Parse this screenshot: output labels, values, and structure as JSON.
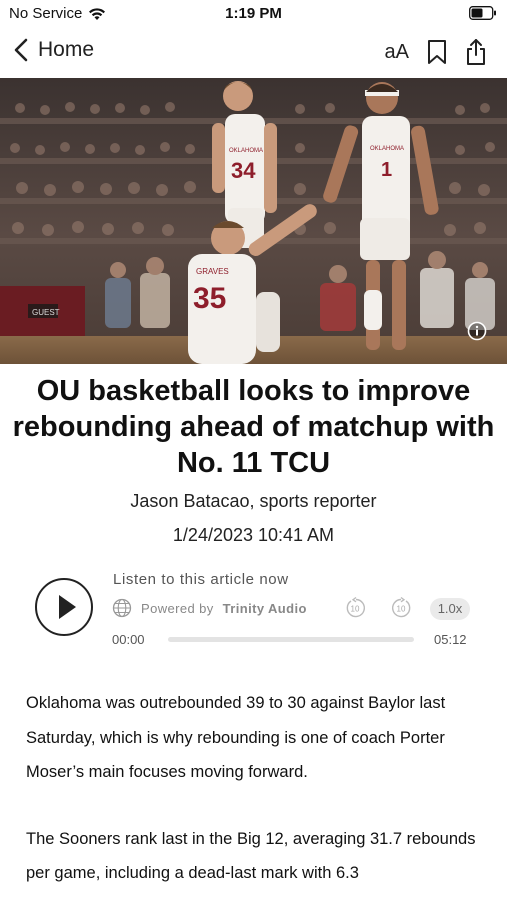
{
  "status_bar": {
    "carrier": "No Service",
    "time": "1:19 PM"
  },
  "nav": {
    "back_label": "Home",
    "font_size_label": "aA"
  },
  "hero": {
    "scoreboard_text": "GUEST",
    "jersey_left_name": "OKLAHOMA",
    "jersey_left_number": "34",
    "jersey_front_name": "GRAVES",
    "jersey_front_number": "35",
    "jersey_right_name": "OKLAHOMA",
    "jersey_right_number": "1"
  },
  "article": {
    "headline": "OU basketball looks to improve rebounding ahead of matchup with No. 11 TCU",
    "byline": "Jason Batacao, sports reporter",
    "date": "1/24/2023 10:41 AM",
    "paragraphs": [
      "Oklahoma was outrebounded 39 to 30 against Baylor last Saturday, which is why rebounding is one of coach Porter Moser’s main focuses moving forward.",
      "The Sooners rank last in the Big 12, averaging 31.7 rebounds per game, including a dead-last mark with 6.3"
    ]
  },
  "audio": {
    "listen_label": "Listen to this article now",
    "powered_by": "Powered by",
    "brand": "Trinity Audio",
    "skip_back_label": "10",
    "skip_forward_label": "10",
    "speed": "1.0x",
    "current_time": "00:00",
    "total_time": "05:12",
    "progress": 0
  },
  "colors": {
    "jersey_crimson": "#8e1e2b",
    "jersey_white": "#f3f0ec",
    "court": "#8a6a4a"
  }
}
